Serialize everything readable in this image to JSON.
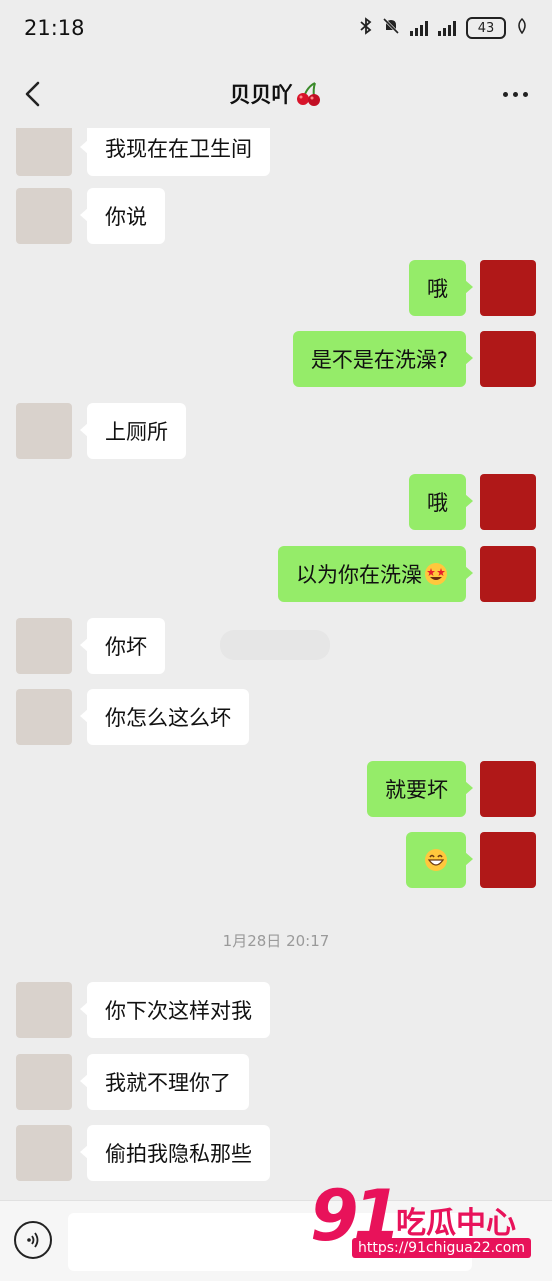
{
  "status_bar": {
    "time": "21:18",
    "battery": "43"
  },
  "header": {
    "contact_name": "贝贝吖",
    "title_emoji": "cherries-emoji"
  },
  "messages": [
    {
      "side": "left",
      "text": "我现在在卫生间"
    },
    {
      "side": "left",
      "text": "你说"
    },
    {
      "side": "right",
      "text": "哦"
    },
    {
      "side": "right",
      "text": "是不是在洗澡?"
    },
    {
      "side": "left",
      "text": "上厕所"
    },
    {
      "side": "right",
      "text": "哦"
    },
    {
      "side": "right",
      "text": "以为你在洗澡",
      "emoji": "star-struck-emoji"
    },
    {
      "side": "left",
      "text": "你坏"
    },
    {
      "side": "left",
      "text": "你怎么这么坏"
    },
    {
      "side": "right",
      "text": "就要坏"
    },
    {
      "side": "right",
      "text": "",
      "emoji": "grinning-emoji"
    },
    {
      "side": "left",
      "text": "你下次这样对我"
    },
    {
      "side": "left",
      "text": "我就不理你了"
    },
    {
      "side": "left",
      "text": "偷拍我隐私那些"
    }
  ],
  "timestamp": "1月28日 20:17",
  "watermark": {
    "number": "91",
    "chinese": "吃瓜中心",
    "url": "https://91chigua22.com"
  },
  "colors": {
    "sent_bubble": "#95ec69",
    "received_bubble": "#ffffff",
    "background": "#ededed",
    "watermark": "#e8125a"
  }
}
